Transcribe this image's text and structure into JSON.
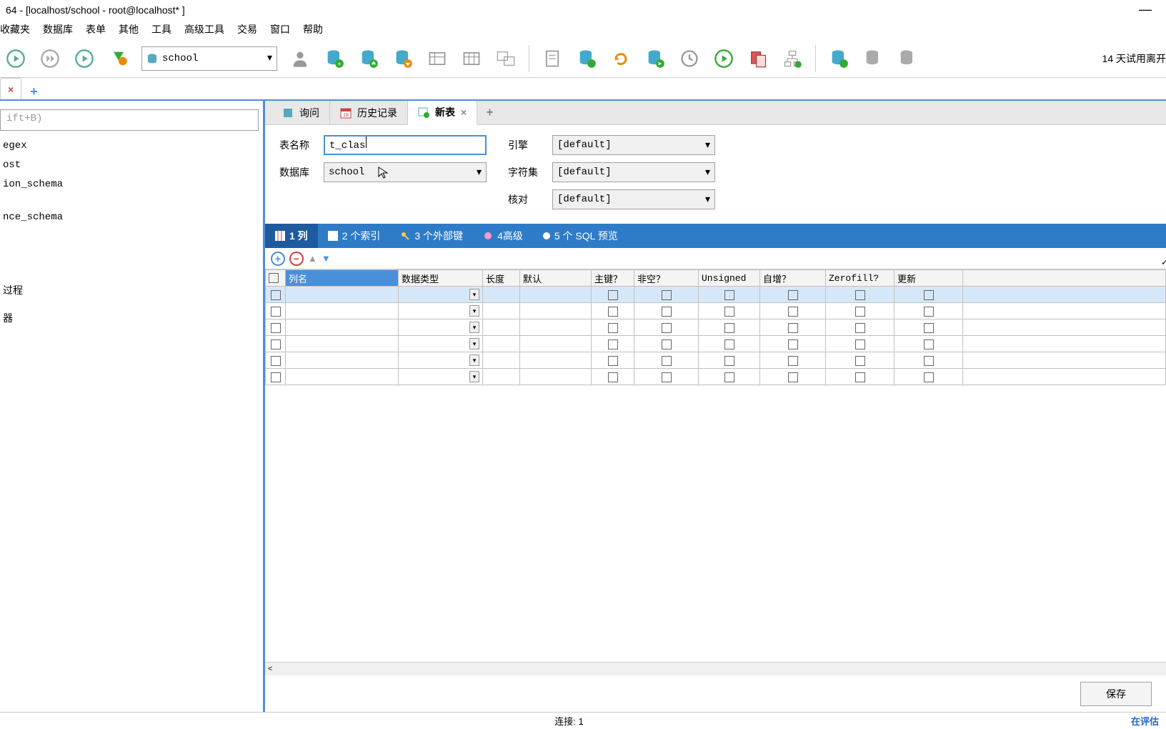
{
  "window": {
    "title": "64 - [localhost/school - root@localhost* ]"
  },
  "menu": {
    "items": [
      "收藏夹",
      "数据库",
      "表单",
      "其他",
      "工具",
      "高级工具",
      "交易",
      "窗口",
      "帮助"
    ]
  },
  "toolbar": {
    "db_selected": "school",
    "trial_text": "14 天试用离开"
  },
  "sidebar": {
    "search_placeholder": "ift+B)",
    "items": [
      "egex",
      "ost",
      "ion_schema",
      "nce_schema",
      "过程",
      "器"
    ]
  },
  "content_tabs": {
    "query": "询问",
    "history": "历史记录",
    "new_table": "新表"
  },
  "form": {
    "table_name_label": "表名称",
    "table_name_value": "t_clas",
    "database_label": "数据库",
    "database_value": "school",
    "engine_label": "引擎",
    "engine_value": "[default]",
    "charset_label": "字符集",
    "charset_value": "[default]",
    "collation_label": "核对",
    "collation_value": "[default]"
  },
  "sub_tabs": {
    "t1": "1 列",
    "t2": "2 个索引",
    "t3": "3 个外部键",
    "t4": "4高级",
    "t5": "5 个 SQL 预览"
  },
  "grid": {
    "headers": [
      "",
      "列名",
      "数据类型",
      "长度",
      "默认",
      "主键？",
      "非空？",
      "Unsigned",
      "自增？",
      "Zerofill?",
      "更新"
    ],
    "row_count": 6
  },
  "save_button": "保存",
  "status": {
    "connection": "连接: 1",
    "eval": "在评估"
  }
}
